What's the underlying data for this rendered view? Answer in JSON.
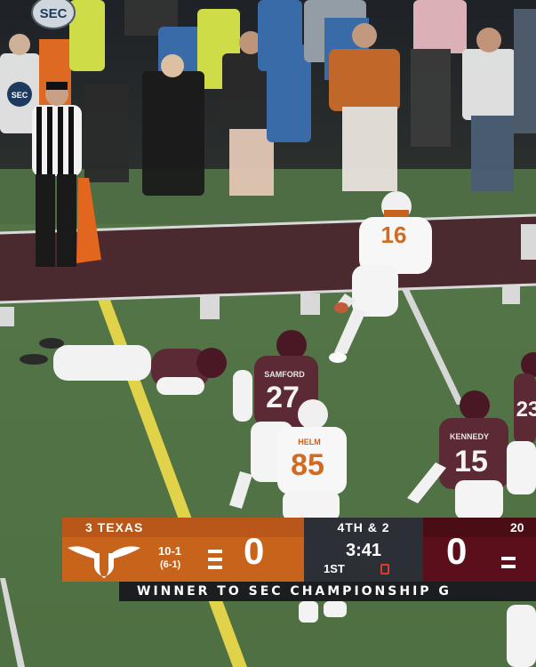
{
  "scoreboard": {
    "away_team_label": "3 TEXAS",
    "away_record_overall": "10-1",
    "away_record_conf": "(6-1)",
    "away_score": "0",
    "down_distance": "4TH & 2",
    "game_clock": "3:41",
    "quarter": "1ST",
    "home_score": "0",
    "partial_right_label": "20",
    "brand_color_away": "#c8631c",
    "brand_color_home": "#5a0f1a"
  },
  "ticker": {
    "text": "WINNER TO SEC CHAMPIONSHIP G"
  },
  "jerseys": {
    "ball_carrier_number": "16",
    "defender_center_number": "27",
    "defender_center_name": "SAMFORD",
    "offense_number": "85",
    "offense_name": "HELM",
    "defender_right_number": "15",
    "defender_right_name": "KENNEDY",
    "defender_edge_number": "23"
  },
  "logos": {
    "conference_logo_text": "SEC",
    "fan_logo_text": "SEC"
  }
}
